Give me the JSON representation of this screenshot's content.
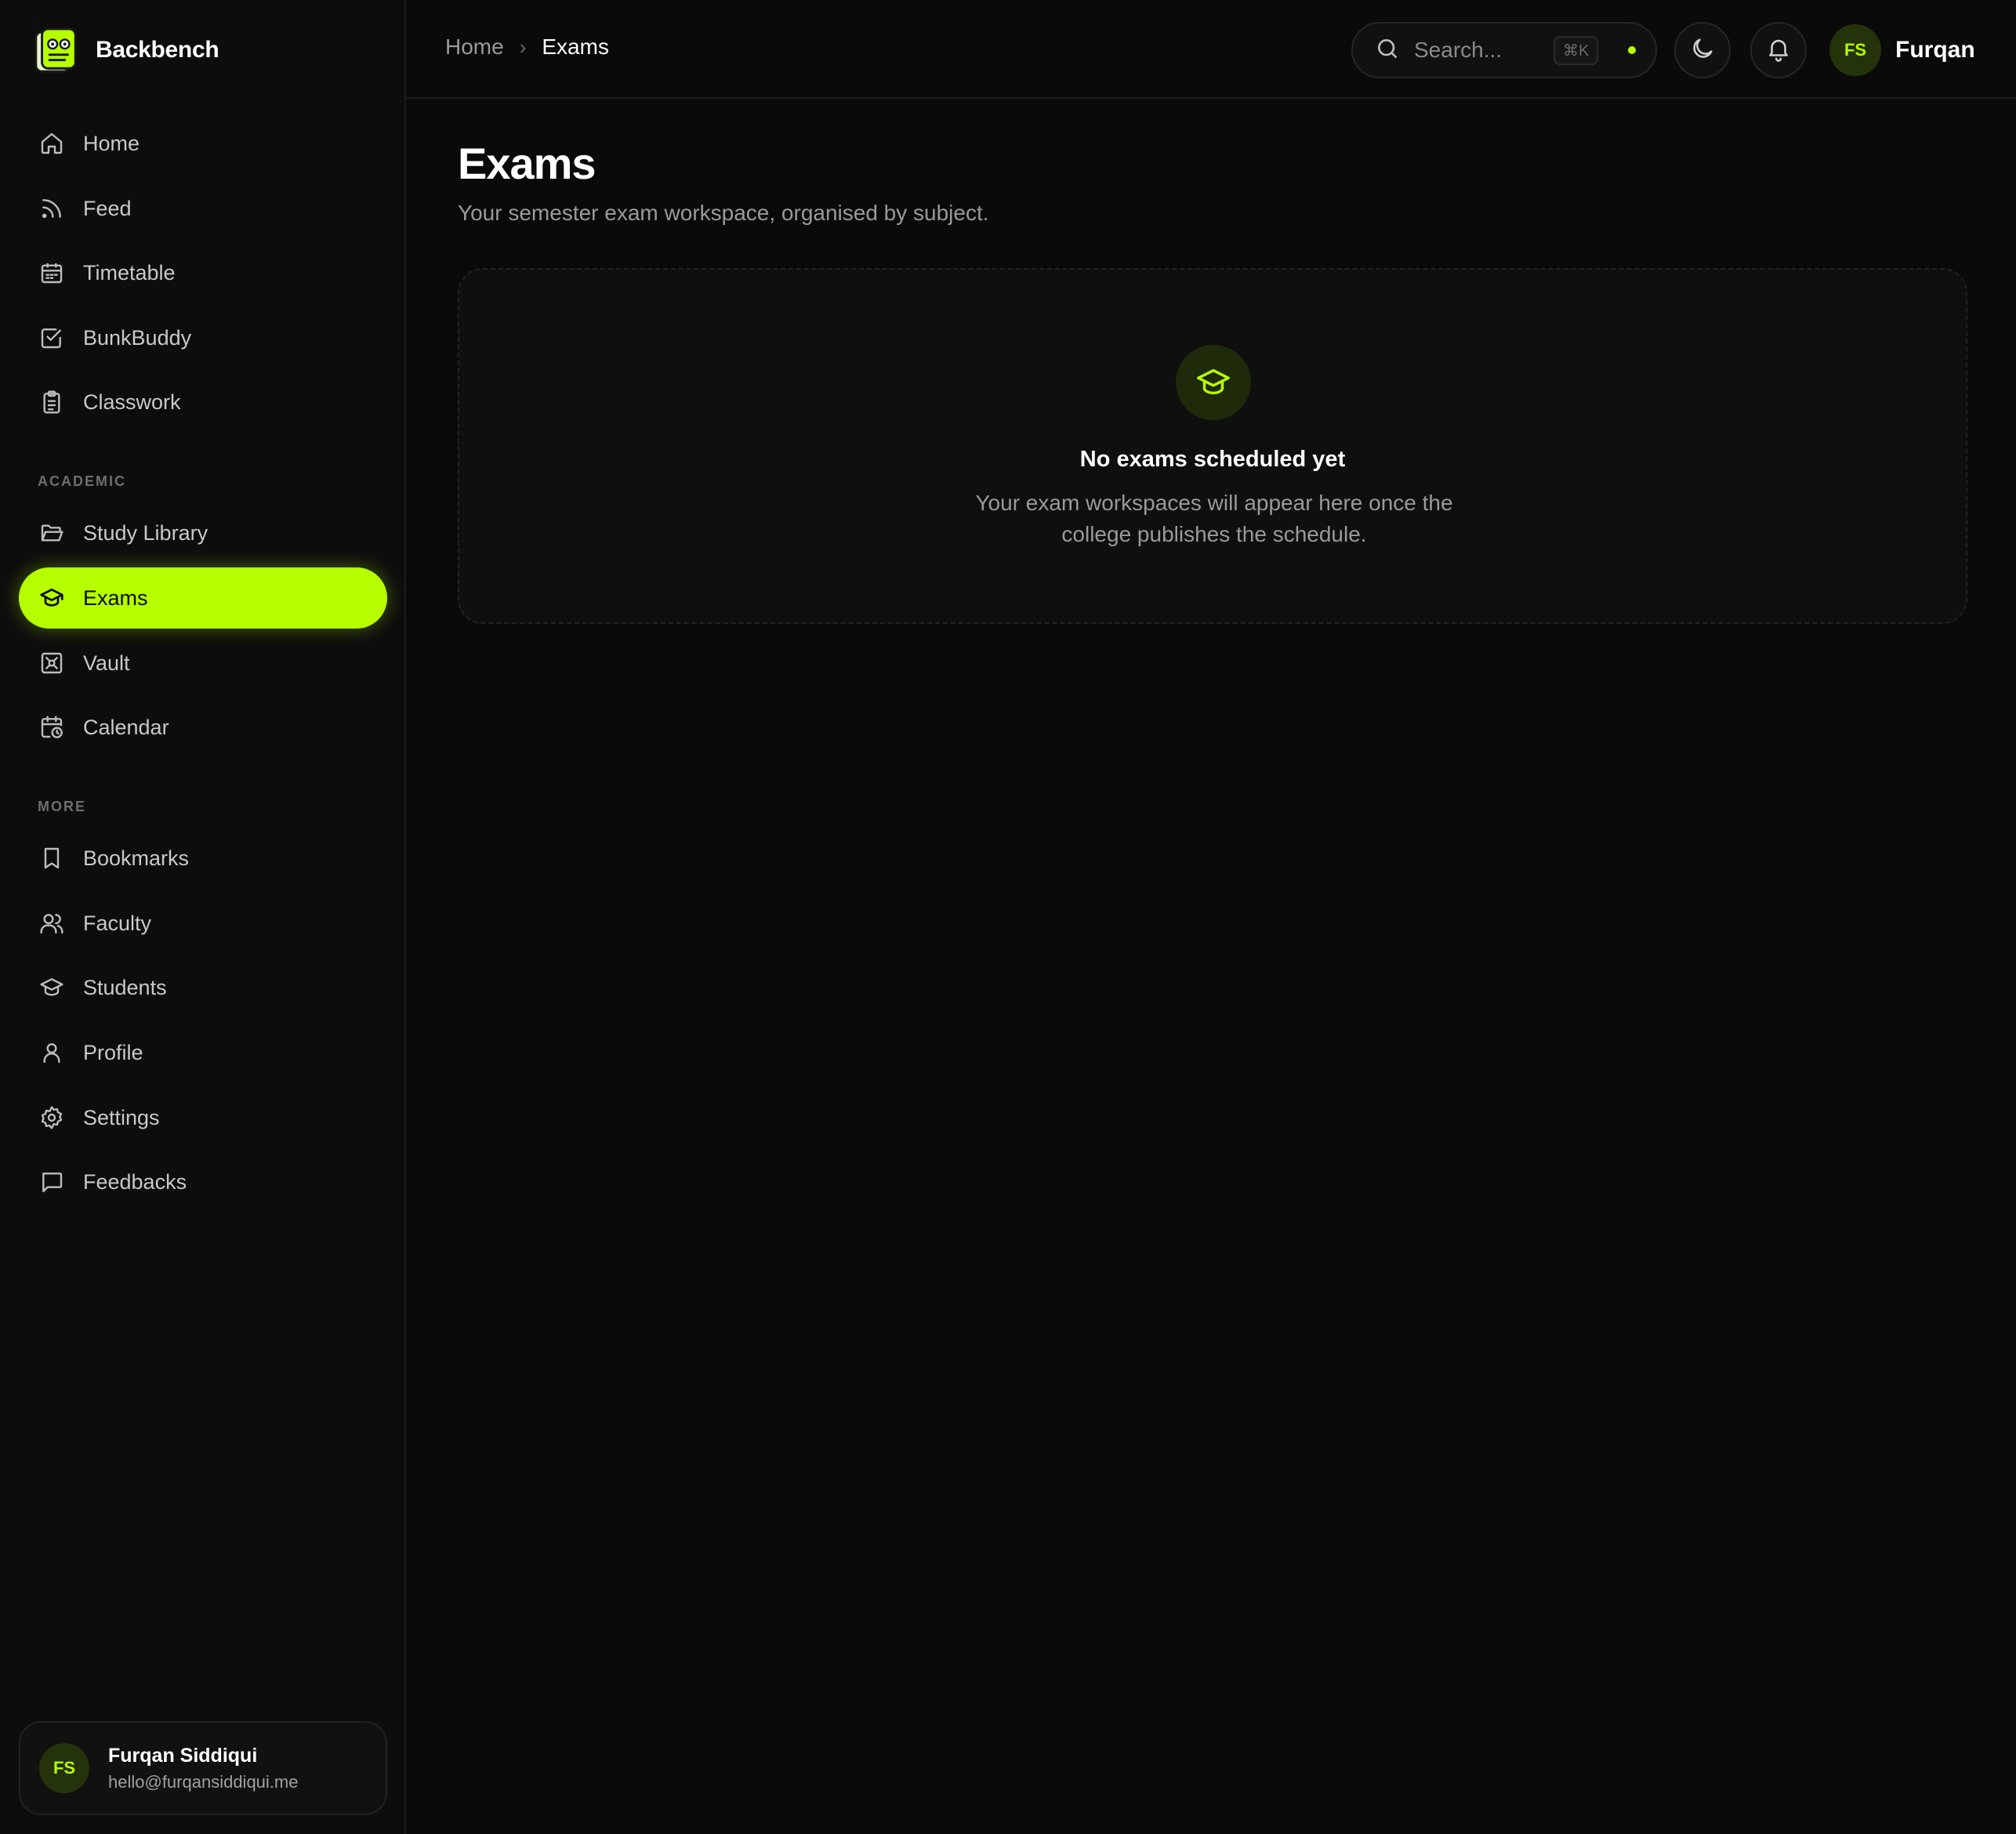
{
  "brand": {
    "name": "Backbench"
  },
  "sidebar": {
    "primary": [
      {
        "label": "Home",
        "icon": "home-icon"
      },
      {
        "label": "Feed",
        "icon": "rss-icon"
      },
      {
        "label": "Timetable",
        "icon": "calendar-grid-icon"
      },
      {
        "label": "BunkBuddy",
        "icon": "check-square-icon"
      },
      {
        "label": "Classwork",
        "icon": "clipboard-list-icon"
      }
    ],
    "academic_label": "ACADEMIC",
    "academic": [
      {
        "label": "Study Library",
        "icon": "folder-open-icon"
      },
      {
        "label": "Exams",
        "icon": "graduation-cap-icon",
        "active": true
      },
      {
        "label": "Vault",
        "icon": "vault-icon"
      },
      {
        "label": "Calendar",
        "icon": "calendar-clock-icon"
      }
    ],
    "more_label": "MORE",
    "more": [
      {
        "label": "Bookmarks",
        "icon": "bookmark-icon"
      },
      {
        "label": "Faculty",
        "icon": "users-icon"
      },
      {
        "label": "Students",
        "icon": "graduation-cap-icon"
      },
      {
        "label": "Profile",
        "icon": "user-icon"
      },
      {
        "label": "Settings",
        "icon": "gear-icon"
      },
      {
        "label": "Feedbacks",
        "icon": "message-square-icon"
      }
    ],
    "user": {
      "initials": "FS",
      "name": "Furqan Siddiqui",
      "email": "hello@furqansiddiqui.me"
    }
  },
  "topbar": {
    "breadcrumb": {
      "home": "Home",
      "separator": "›",
      "current": "Exams"
    },
    "search": {
      "placeholder": "Search...",
      "shortcut": "⌘K"
    },
    "user": {
      "initials": "FS",
      "name": "Furqan"
    }
  },
  "main": {
    "title": "Exams",
    "subtitle": "Your semester exam workspace, organised by subject.",
    "empty_state": {
      "title": "No exams scheduled yet",
      "text": "Your exam workspaces will appear here once the college publishes the schedule."
    }
  },
  "colors": {
    "accent": "#b6ff00",
    "background": "#0a0a0a",
    "sidebar": "#0d0d0d"
  }
}
